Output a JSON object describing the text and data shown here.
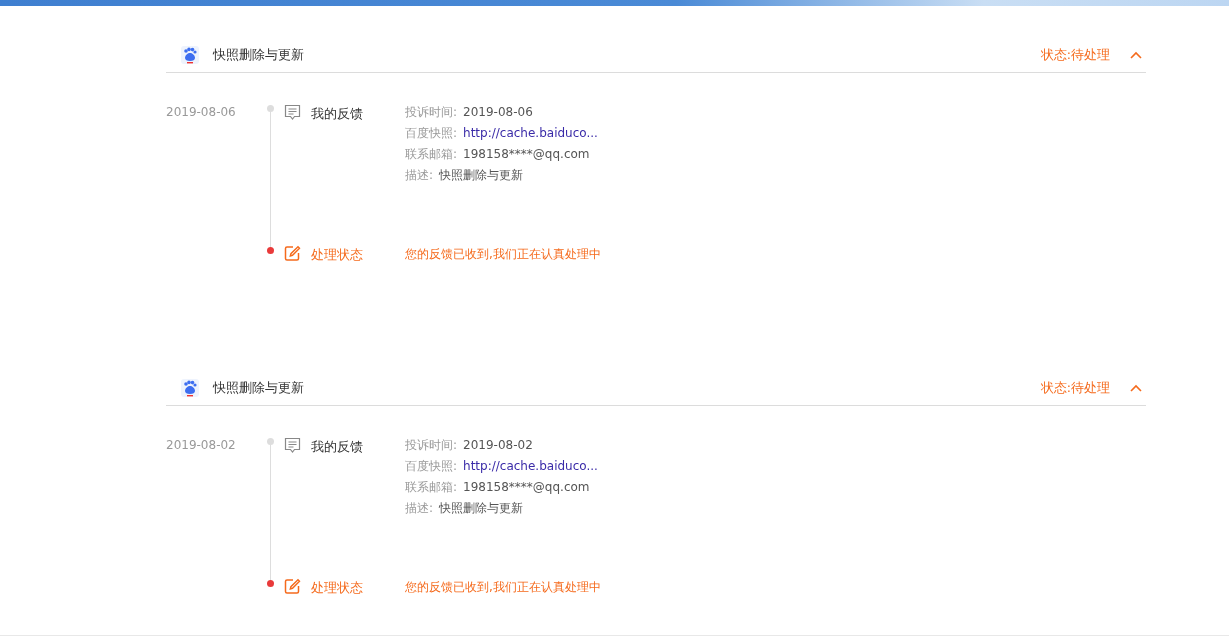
{
  "records": [
    {
      "title": "快照删除与更新",
      "status": "状态:待处理",
      "expanded": true,
      "date": "2019-08-06",
      "feedback_label": "我的反馈",
      "fields": [
        {
          "label": "投诉时间:",
          "value": "2019-08-06",
          "kind": "text"
        },
        {
          "label": "百度快照:",
          "value": "http://cache.baiduco...",
          "kind": "link"
        },
        {
          "label": "联系邮箱:",
          "value": "198158****@qq.com",
          "kind": "text"
        },
        {
          "label": "描述:",
          "value": "快照删除与更新",
          "kind": "text"
        }
      ],
      "progress_label": "处理状态",
      "progress_message": "您的反馈已收到,我们正在认真处理中"
    },
    {
      "title": "快照删除与更新",
      "status": "状态:待处理",
      "expanded": true,
      "date": "2019-08-02",
      "feedback_label": "我的反馈",
      "fields": [
        {
          "label": "投诉时间:",
          "value": "2019-08-02",
          "kind": "text"
        },
        {
          "label": "百度快照:",
          "value": "http://cache.baiduco...",
          "kind": "link"
        },
        {
          "label": "联系邮箱:",
          "value": "198158****@qq.com",
          "kind": "text"
        },
        {
          "label": "描述:",
          "value": "快照删除与更新",
          "kind": "text"
        }
      ],
      "progress_label": "处理状态",
      "progress_message": "您的反馈已收到,我们正在认真处理中"
    }
  ]
}
